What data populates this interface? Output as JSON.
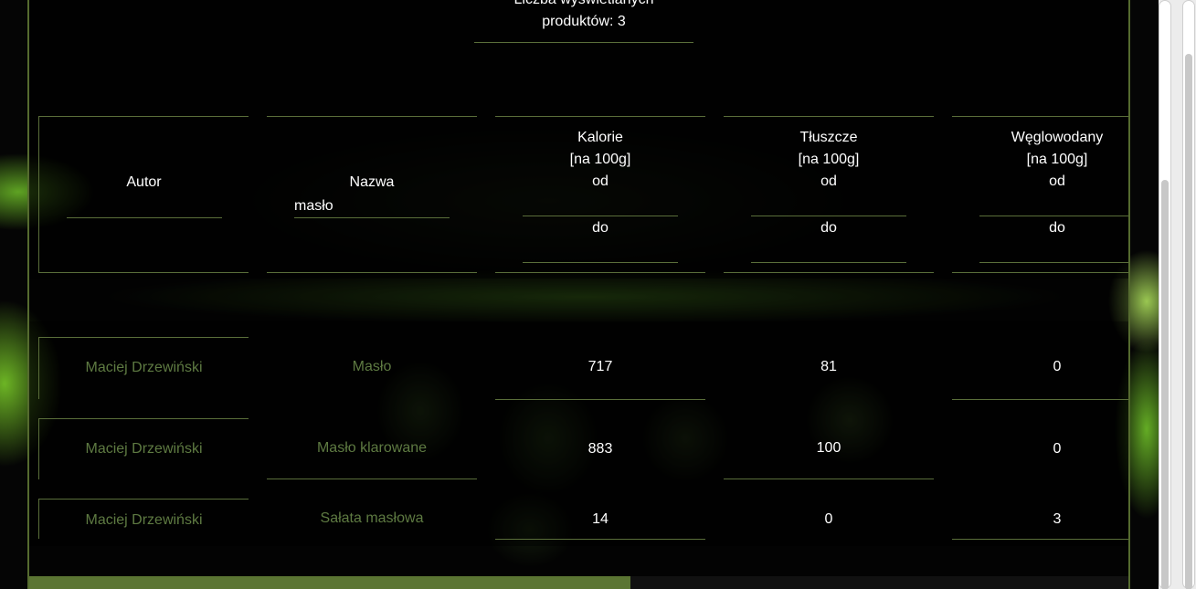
{
  "count": {
    "line1": "Liczba wyświetlanych",
    "line2": "produktów: 3"
  },
  "filters": {
    "author": {
      "label": "Autor",
      "value": ""
    },
    "name": {
      "label": "Nazwa",
      "value": "masło"
    },
    "calories": {
      "label1": "Kalorie",
      "label2": "[na 100g]",
      "from": "od",
      "to": "do"
    },
    "fat": {
      "label1": "Tłuszcze",
      "label2": "[na 100g]",
      "from": "od",
      "to": "do"
    },
    "carbs": {
      "label1": "Węglowodany",
      "label2": "[na 100g]",
      "from": "od",
      "to": "do"
    }
  },
  "rows": [
    {
      "author": "Maciej Drzewiński",
      "name": "Masło",
      "calories": "717",
      "fat": "81",
      "carbs": "0"
    },
    {
      "author": "Maciej Drzewiński",
      "name": "Masło klarowane",
      "calories": "883",
      "fat": "100",
      "carbs": "0"
    },
    {
      "author": "Maciej Drzewiński",
      "name": "Sałata masłowa",
      "calories": "14",
      "fat": "0",
      "carbs": "3"
    }
  ],
  "colors": {
    "accent": "#5b7533",
    "muted_text": "#5e7a42"
  },
  "scroll": {
    "horizontal_position_fraction": 0.55
  }
}
